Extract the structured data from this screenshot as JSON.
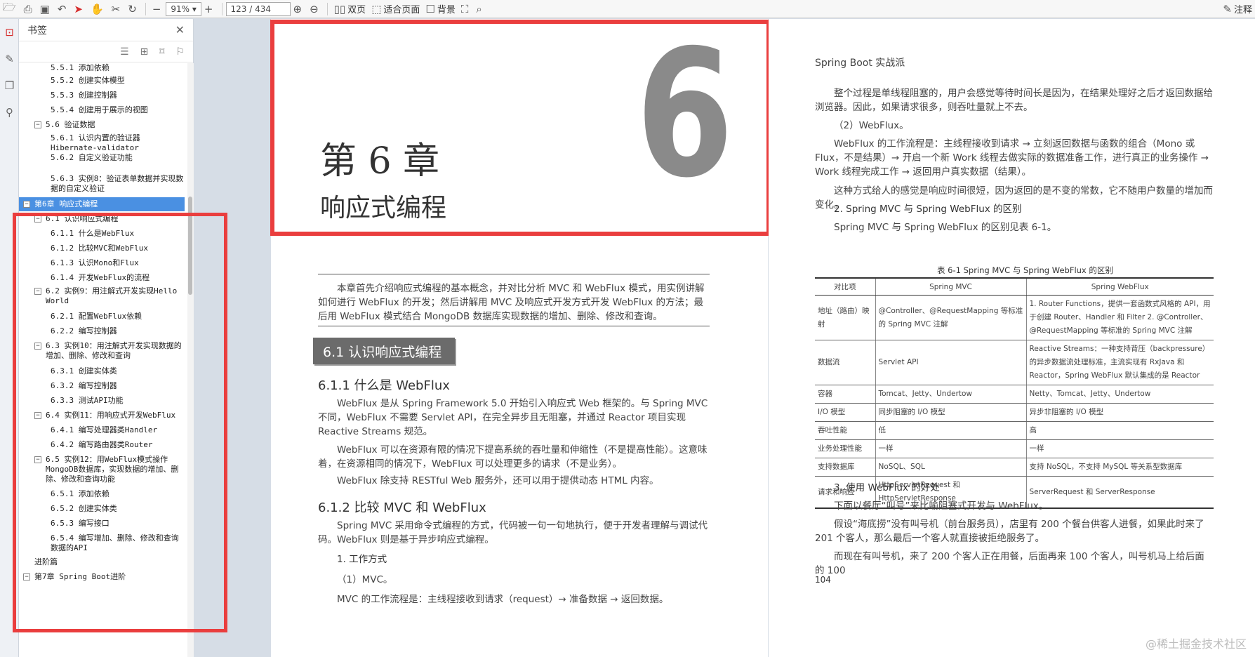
{
  "toolbar": {
    "page_current": "123",
    "page_total": "/ 434",
    "zoom": "91%",
    "dual_page": "双页",
    "fit_page": "适合页面",
    "background": "背景",
    "annotate": "注释"
  },
  "bookmarks": {
    "title": "书签",
    "items": [
      {
        "label": "5.5.1 添加依赖",
        "level": 3
      },
      {
        "label": "5.5.2 创建实体模型",
        "level": 3
      },
      {
        "label": "5.5.3 创建控制器",
        "level": 3
      },
      {
        "label": "5.5.4 创建用于展示的视图",
        "level": 3
      },
      {
        "label": "5.6 验证数据",
        "level": 2
      },
      {
        "label": "5.6.1 认识内置的验证器Hibernate-validator",
        "level": 3
      },
      {
        "label": "5.6.2 自定义验证功能",
        "level": 3
      },
      {
        "label": "5.6.3 实例8：验证表单数据并实现数据的自定义验证",
        "level": 3
      },
      {
        "label": "第6章 响应式编程",
        "level": 1
      },
      {
        "label": "6.1 认识响应式编程",
        "level": 2
      },
      {
        "label": "6.1.1 什么是WebFlux",
        "level": 3
      },
      {
        "label": "6.1.2 比较MVC和WebFlux",
        "level": 3
      },
      {
        "label": "6.1.3 认识Mono和Flux",
        "level": 3
      },
      {
        "label": "6.1.4 开发WebFlux的流程",
        "level": 3
      },
      {
        "label": "6.2 实例9：用注解式开发实现Hello World",
        "level": 2
      },
      {
        "label": "6.2.1 配置WebFlux依赖",
        "level": 3
      },
      {
        "label": "6.2.2 编写控制器",
        "level": 3
      },
      {
        "label": "6.3 实例10：用注解式开发实现数据的增加、删除、修改和查询",
        "level": 2
      },
      {
        "label": "6.3.1 创建实体类",
        "level": 3
      },
      {
        "label": "6.3.2 编写控制器",
        "level": 3
      },
      {
        "label": "6.3.3 测试API功能",
        "level": 3
      },
      {
        "label": "6.4 实例11：用响应式开发WebFlux",
        "level": 2
      },
      {
        "label": "6.4.1 编写处理器类Handler",
        "level": 3
      },
      {
        "label": "6.4.2 编写路由器类Router",
        "level": 3
      },
      {
        "label": "6.5 实例12：用WebFlux模式操作MongoDB数据库，实现数据的增加、删除、修改和查询功能",
        "level": 2
      },
      {
        "label": "6.5.1 添加依赖",
        "level": 3
      },
      {
        "label": "6.5.2 创建实体类",
        "level": 3
      },
      {
        "label": "6.5.3 编写接口",
        "level": 3
      },
      {
        "label": "6.5.4 编写增加、删除、修改和查询数据的API",
        "level": 3
      },
      {
        "label": "进阶篇",
        "level": 1
      },
      {
        "label": "第7章 Spring Boot进阶",
        "level": 1
      }
    ]
  },
  "page_left": {
    "big_number": "6",
    "chapter_title": "第 6 章",
    "chapter_subtitle": "响应式编程",
    "intro": "本章首先介绍响应式编程的基本概念，并对比分析 MVC 和 WebFlux 模式，用实例讲解如何进行 WebFlux 的开发；然后讲解用 MVC 及响应式开发方式开发 WebFlux 的方法；最后用 WebFlux 模式结合 MongoDB 数据库实现数据的增加、删除、修改和查询。",
    "section": "6.1 认识响应式编程",
    "h611": "6.1.1 什么是 WebFlux",
    "p1": "WebFlux 是从 Spring Framework 5.0 开始引入响应式 Web 框架的。与 Spring MVC 不同，WebFlux 不需要 Servlet API，在完全异步且无阻塞，并通过 Reactor 项目实现 Reactive Streams 规范。",
    "p2": "WebFlux 可以在资源有限的情况下提高系统的吞吐量和伸缩性（不是提高性能）。这意味着，在资源相同的情况下，WebFlux 可以处理更多的请求（不是业务）。",
    "p3": "WebFlux 除支持 RESTful Web 服务外，还可以用于提供动态 HTML 内容。",
    "h612": "6.1.2 比较 MVC 和 WebFlux",
    "p4": "Spring MVC 采用命令式编程的方式，代码被一句一句地执行，便于开发者理解与调试代码。WebFlux 则是基于异步响应式编程。",
    "p5": "1. 工作方式",
    "p6": "（1）MVC。",
    "p7": "MVC 的工作流程是：主线程接收到请求（request）→ 准备数据 → 返回数据。"
  },
  "page_right": {
    "header": "Spring Boot 实战派",
    "p1": "整个过程是单线程阻塞的，用户会感觉等待时间长是因为，在结果处理好之后才返回数据给浏览器。因此，如果请求很多，则吞吐量就上不去。",
    "p2": "（2）WebFlux。",
    "p3": "WebFlux 的工作流程是：主线程接收到请求 → 立刻返回数据与函数的组合（Mono 或 Flux，不是结果）→ 开启一个新 Work 线程去做实际的数据准备工作，进行真正的业务操作 → Work 线程完成工作 → 返回用户真实数据（结果）。",
    "p4": "这种方式给人的感觉是响应时间很短，因为返回的是不变的常数，它不随用户数量的增加而变化。",
    "h2": "2. Spring MVC 与 Spring WebFlux 的区别",
    "p5": "Spring MVC 与 Spring WebFlux 的区别见表 6-1。",
    "caption": "表 6-1 Spring MVC 与 Spring WebFlux 的区别",
    "table": {
      "headers": [
        "对比项",
        "Spring MVC",
        "Spring WebFlux"
      ],
      "rows": [
        [
          "地址（路由）映射",
          "@Controller、@RequestMapping 等标准的 Spring MVC 注解",
          "1. Router Functions，提供一套函数式风格的 API，用于创建 Router、Handler 和 Filter 2. @Controller、@RequestMapping 等标准的 Spring MVC 注解"
        ],
        [
          "数据流",
          "Servlet API",
          "Reactive Streams：一种支持背压（backpressure）的异步数据流处理标准，主流实现有 RxJava 和 Reactor，Spring WebFlux 默认集成的是 Reactor"
        ],
        [
          "容器",
          "Tomcat、Jetty、Undertow",
          "Netty、Tomcat、Jetty、Undertow"
        ],
        [
          "I/O 模型",
          "同步阻塞的 I/O 模型",
          "异步非阻塞的 I/O 模型"
        ],
        [
          "吞吐性能",
          "低",
          "高"
        ],
        [
          "业务处理性能",
          "一样",
          "一样"
        ],
        [
          "支持数据库",
          "NoSQL、SQL",
          "支持 NoSQL，不支持 MySQL 等关系型数据库"
        ],
        [
          "请求和响应",
          "HttpServletRequest 和 HttpServletResponse",
          "ServerRequest 和 ServerResponse"
        ]
      ]
    },
    "h3": "3. 使用 WebFlux 的好处",
    "p6": "下面以餐厅“叫号”来比喻阻塞式开发与 WebFlux。",
    "p7": "假设“海底捞”没有叫号机（前台服务员），店里有 200 个餐台供客人进餐，如果此时来了 201 个客人，那么最后一个客人就直接被拒绝服务了。",
    "p8": "而现在有叫号机，来了 200 个客人正在用餐，后面再来 100 个客人，叫号机马上给后面的 100",
    "page_number": "104",
    "watermark": "@稀土掘金技术社区"
  }
}
